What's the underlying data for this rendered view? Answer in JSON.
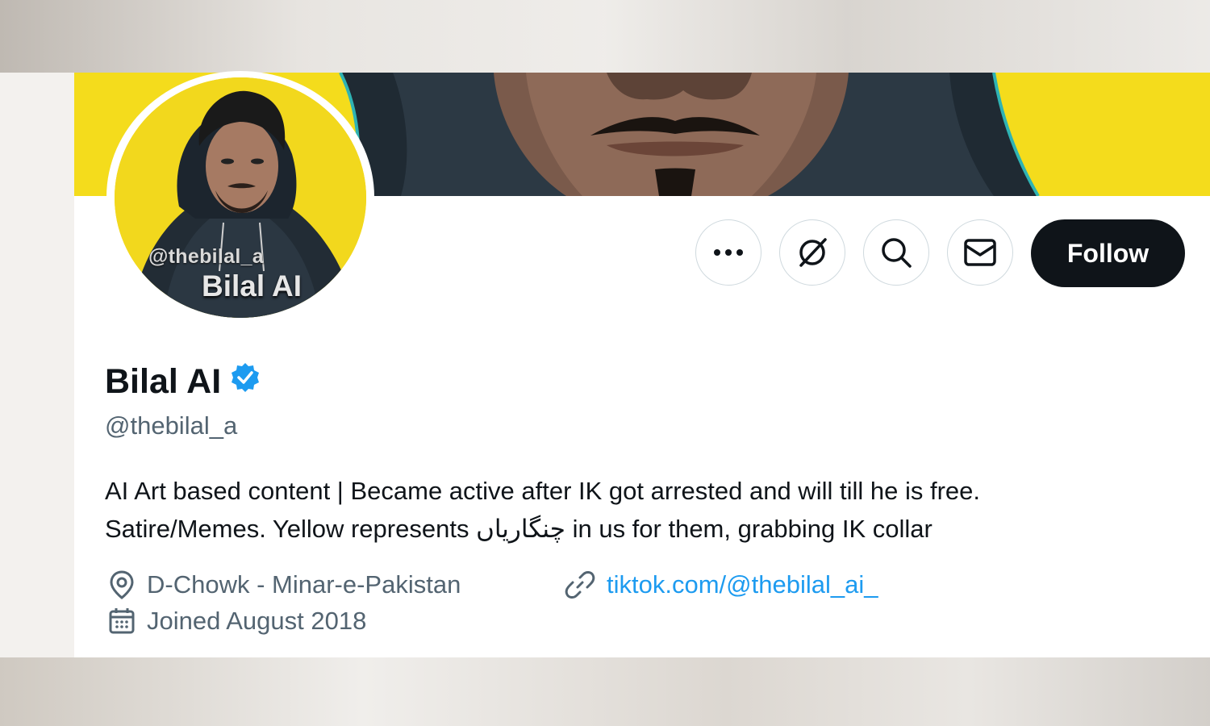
{
  "profile": {
    "display_name": "Bilal AI",
    "handle": "@thebilal_a",
    "verified_icon": "verified-badge-icon",
    "bio_line1": "AI Art based content | Became active after IK got arrested and will till he is free.",
    "bio_line2": "Satire/Memes. Yellow represents چنگاریاں in us for them, grabbing IK collar",
    "location": "D-Chowk - Minar-e-Pakistan",
    "website": "tiktok.com/@thebilal_ai_",
    "joined": "Joined August 2018"
  },
  "avatar": {
    "watermark": "@thebilal_a",
    "name": "Bilal AI"
  },
  "actions": {
    "more_icon": "more-icon",
    "grok_icon": "grok-icon",
    "search_icon": "search-icon",
    "message_icon": "mail-icon",
    "follow_label": "Follow"
  },
  "colors": {
    "banner": "#f4dc1c",
    "accent": "#1d9bf0",
    "text_primary": "#0f1419",
    "text_secondary": "#536471",
    "button_dark": "#0f1419"
  }
}
